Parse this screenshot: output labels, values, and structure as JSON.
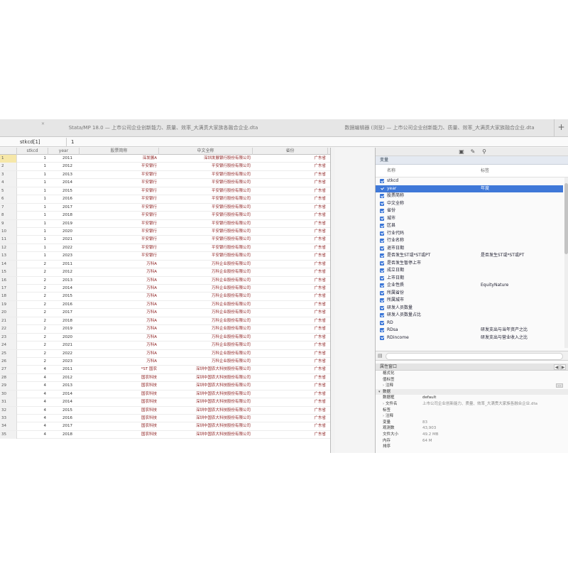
{
  "tabs": [
    {
      "label": "Stata/MP 18.0 — 上市公司企业创新能力、质量、效率_大满贯大家族各融合企业.dta"
    },
    {
      "label": "数据编辑器 (浏览) — 上市公司企业创新能力、质量、效率_大满贯大家族融合企业.dta"
    }
  ],
  "tab_plus": "+",
  "cell_ref": "stkcd[1]",
  "cell_value": "1",
  "grid_headers": [
    "stkcd",
    "year",
    "股票简称",
    "中文全称",
    "省份"
  ],
  "rows": [
    {
      "rn": "1",
      "code": "1",
      "year": "2011",
      "abbr": "深发展A",
      "name": "深圳发展银行股份有限公司",
      "prov": "广东省"
    },
    {
      "rn": "2",
      "code": "1",
      "year": "2012",
      "abbr": "平安银行",
      "name": "平安银行股份有限公司",
      "prov": "广东省"
    },
    {
      "rn": "3",
      "code": "1",
      "year": "2013",
      "abbr": "平安银行",
      "name": "平安银行股份有限公司",
      "prov": "广东省"
    },
    {
      "rn": "4",
      "code": "1",
      "year": "2014",
      "abbr": "平安银行",
      "name": "平安银行股份有限公司",
      "prov": "广东省"
    },
    {
      "rn": "5",
      "code": "1",
      "year": "2015",
      "abbr": "平安银行",
      "name": "平安银行股份有限公司",
      "prov": "广东省"
    },
    {
      "rn": "6",
      "code": "1",
      "year": "2016",
      "abbr": "平安银行",
      "name": "平安银行股份有限公司",
      "prov": "广东省"
    },
    {
      "rn": "7",
      "code": "1",
      "year": "2017",
      "abbr": "平安银行",
      "name": "平安银行股份有限公司",
      "prov": "广东省"
    },
    {
      "rn": "8",
      "code": "1",
      "year": "2018",
      "abbr": "平安银行",
      "name": "平安银行股份有限公司",
      "prov": "广东省"
    },
    {
      "rn": "9",
      "code": "1",
      "year": "2019",
      "abbr": "平安银行",
      "name": "平安银行股份有限公司",
      "prov": "广东省"
    },
    {
      "rn": "10",
      "code": "1",
      "year": "2020",
      "abbr": "平安银行",
      "name": "平安银行股份有限公司",
      "prov": "广东省"
    },
    {
      "rn": "11",
      "code": "1",
      "year": "2021",
      "abbr": "平安银行",
      "name": "平安银行股份有限公司",
      "prov": "广东省"
    },
    {
      "rn": "12",
      "code": "1",
      "year": "2022",
      "abbr": "平安银行",
      "name": "平安银行股份有限公司",
      "prov": "广东省"
    },
    {
      "rn": "13",
      "code": "1",
      "year": "2023",
      "abbr": "平安银行",
      "name": "平安银行股份有限公司",
      "prov": "广东省"
    },
    {
      "rn": "14",
      "code": "2",
      "year": "2011",
      "abbr": "万科A",
      "name": "万科企业股份有限公司",
      "prov": "广东省"
    },
    {
      "rn": "15",
      "code": "2",
      "year": "2012",
      "abbr": "万科A",
      "name": "万科企业股份有限公司",
      "prov": "广东省"
    },
    {
      "rn": "16",
      "code": "2",
      "year": "2013",
      "abbr": "万科A",
      "name": "万科企业股份有限公司",
      "prov": "广东省"
    },
    {
      "rn": "17",
      "code": "2",
      "year": "2014",
      "abbr": "万科A",
      "name": "万科企业股份有限公司",
      "prov": "广东省"
    },
    {
      "rn": "18",
      "code": "2",
      "year": "2015",
      "abbr": "万科A",
      "name": "万科企业股份有限公司",
      "prov": "广东省"
    },
    {
      "rn": "19",
      "code": "2",
      "year": "2016",
      "abbr": "万科A",
      "name": "万科企业股份有限公司",
      "prov": "广东省"
    },
    {
      "rn": "20",
      "code": "2",
      "year": "2017",
      "abbr": "万科A",
      "name": "万科企业股份有限公司",
      "prov": "广东省"
    },
    {
      "rn": "21",
      "code": "2",
      "year": "2018",
      "abbr": "万科A",
      "name": "万科企业股份有限公司",
      "prov": "广东省"
    },
    {
      "rn": "22",
      "code": "2",
      "year": "2019",
      "abbr": "万科A",
      "name": "万科企业股份有限公司",
      "prov": "广东省"
    },
    {
      "rn": "23",
      "code": "2",
      "year": "2020",
      "abbr": "万科A",
      "name": "万科企业股份有限公司",
      "prov": "广东省"
    },
    {
      "rn": "24",
      "code": "2",
      "year": "2021",
      "abbr": "万科A",
      "name": "万科企业股份有限公司",
      "prov": "广东省"
    },
    {
      "rn": "25",
      "code": "2",
      "year": "2022",
      "abbr": "万科A",
      "name": "万科企业股份有限公司",
      "prov": "广东省"
    },
    {
      "rn": "26",
      "code": "2",
      "year": "2023",
      "abbr": "万科A",
      "name": "万科企业股份有限公司",
      "prov": "广东省"
    },
    {
      "rn": "27",
      "code": "4",
      "year": "2011",
      "abbr": "*ST 国农",
      "name": "深圳中国农大科技股份有限公司",
      "prov": "广东省"
    },
    {
      "rn": "28",
      "code": "4",
      "year": "2012",
      "abbr": "国农科技",
      "name": "深圳中国农大科技股份有限公司",
      "prov": "广东省"
    },
    {
      "rn": "29",
      "code": "4",
      "year": "2013",
      "abbr": "国农科技",
      "name": "深圳中国农大科技股份有限公司",
      "prov": "广东省"
    },
    {
      "rn": "30",
      "code": "4",
      "year": "2014",
      "abbr": "国农科技",
      "name": "深圳中国农大科技股份有限公司",
      "prov": "广东省"
    },
    {
      "rn": "31",
      "code": "4",
      "year": "2014",
      "abbr": "国农科技",
      "name": "深圳中国农大科技股份有限公司",
      "prov": "广东省"
    },
    {
      "rn": "32",
      "code": "4",
      "year": "2015",
      "abbr": "国农科技",
      "name": "深圳中国农大科技股份有限公司",
      "prov": "广东省"
    },
    {
      "rn": "33",
      "code": "4",
      "year": "2016",
      "abbr": "国农科技",
      "name": "深圳中国农大科技股份有限公司",
      "prov": "广东省"
    },
    {
      "rn": "34",
      "code": "4",
      "year": "2017",
      "abbr": "国农科技",
      "name": "深圳中国农大科技股份有限公司",
      "prov": "广东省"
    },
    {
      "rn": "35",
      "code": "4",
      "year": "2018",
      "abbr": "国农科技",
      "name": "深圳中国农大科技股份有限公司",
      "prov": "广东省"
    }
  ],
  "var_panel_title": "变量",
  "var_col_name": "名称",
  "var_col_label": "标签",
  "variables": [
    {
      "name": "stkcd",
      "label": ""
    },
    {
      "name": "year",
      "label": "年度"
    },
    {
      "name": "股票简称",
      "label": ""
    },
    {
      "name": "中文全称",
      "label": ""
    },
    {
      "name": "省份",
      "label": ""
    },
    {
      "name": "城市",
      "label": ""
    },
    {
      "name": "区县",
      "label": ""
    },
    {
      "name": "行业代码",
      "label": ""
    },
    {
      "name": "行业名称",
      "label": ""
    },
    {
      "name": "退市日期",
      "label": ""
    },
    {
      "name": "是否发生ST或*ST或PT",
      "label": "是否发生ST或*ST或PT"
    },
    {
      "name": "是否发生暂停上市",
      "label": ""
    },
    {
      "name": "成立日期",
      "label": ""
    },
    {
      "name": "上市日期",
      "label": ""
    },
    {
      "name": "企业性质",
      "label": "EquityNature"
    },
    {
      "name": "所属省份",
      "label": ""
    },
    {
      "name": "所属城市",
      "label": ""
    },
    {
      "name": "研发人员数量",
      "label": ""
    },
    {
      "name": "研发人员数量占比",
      "label": ""
    },
    {
      "name": "RD",
      "label": ""
    },
    {
      "name": "RDsa",
      "label": "研发支出与当年资产之比"
    },
    {
      "name": "RDincome",
      "label": "研发支出与营业收入之比"
    }
  ],
  "search_placeholder": "",
  "props_title": "属性窗口",
  "props_nav": [
    "◀",
    "▶"
  ],
  "props": [
    {
      "key": "格式化",
      "value": "",
      "kind": "item"
    },
    {
      "key": "值标签",
      "value": "",
      "kind": "item"
    },
    {
      "key": "注释",
      "value": "",
      "kind": "sub-group"
    },
    {
      "key": "数据",
      "value": "",
      "kind": "group"
    },
    {
      "key": "数据框",
      "value": "default",
      "kind": "item"
    },
    {
      "key": "文件名",
      "value": "上市公司企业创新能力、质量、效率_大满贯大家族各融合企业.dta",
      "kind": "sub-item"
    },
    {
      "key": "标签",
      "value": "",
      "kind": "item"
    },
    {
      "key": "注释",
      "value": "",
      "kind": "sub-item"
    },
    {
      "key": "变量",
      "value": "83",
      "kind": "item"
    },
    {
      "key": "观测数",
      "value": "43,903",
      "kind": "item"
    },
    {
      "key": "文件大小",
      "value": "49.2 MB",
      "kind": "item"
    },
    {
      "key": "内存",
      "value": "64 M",
      "kind": "item"
    },
    {
      "key": "排序",
      "value": "",
      "kind": "item"
    }
  ],
  "props_more": "...",
  "selected_row": "1",
  "highlight_var": "year",
  "colors": {
    "highlight": "#3f78d8",
    "text_red": "#8a1a1a",
    "selected_row": "#f6e7a8"
  }
}
